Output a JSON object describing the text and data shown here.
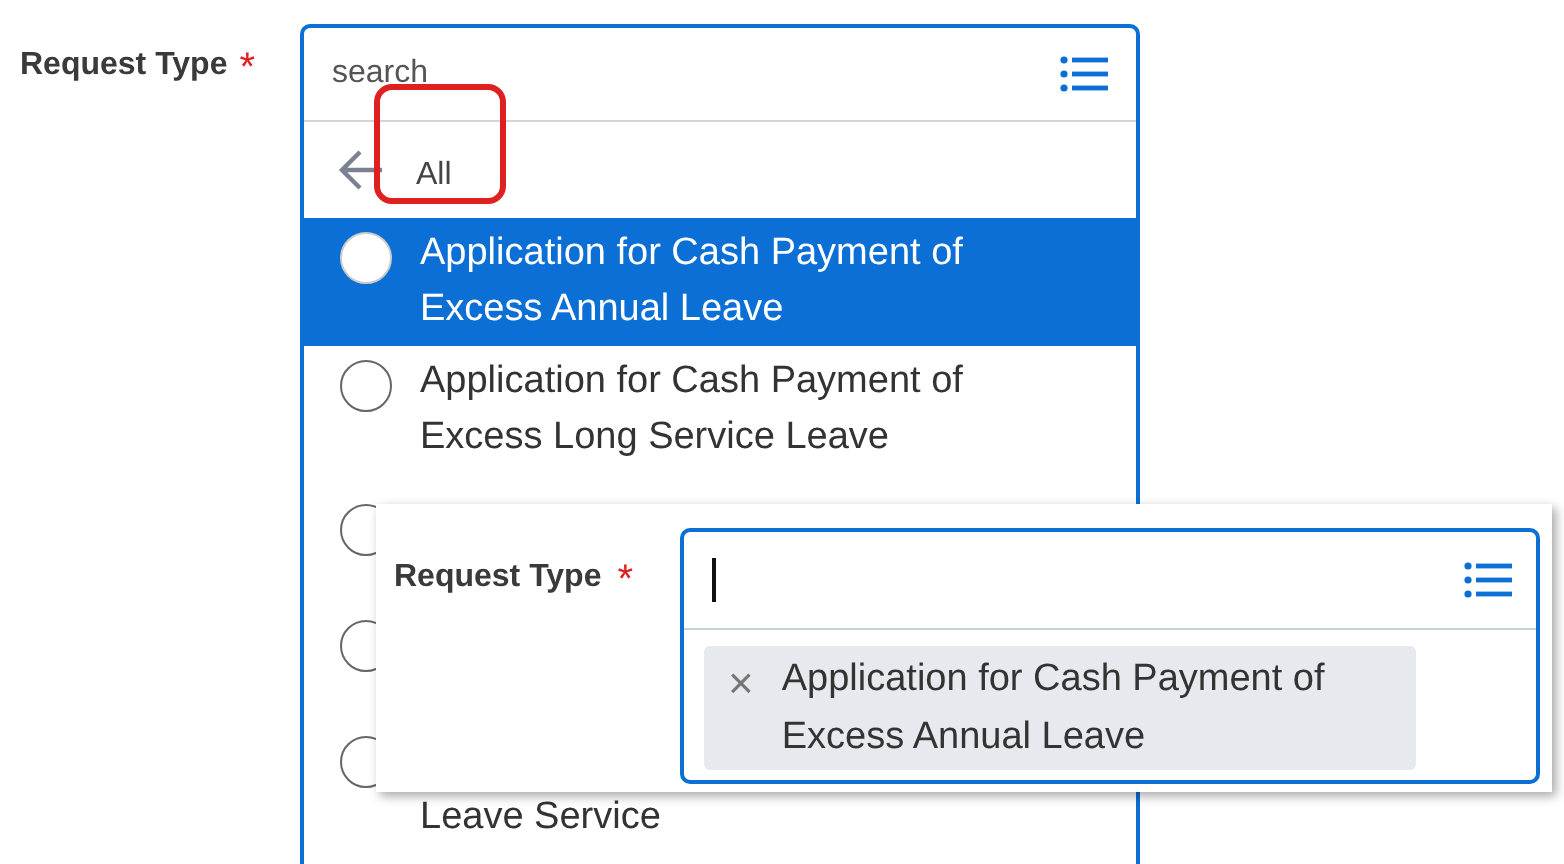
{
  "field": {
    "label": "Request Type",
    "required_mark": "*",
    "placeholder": "search"
  },
  "back": {
    "label": "All"
  },
  "options": [
    {
      "kind": "full",
      "label": "Application for Cash Payment of Excess Annual Leave",
      "selected": true
    },
    {
      "kind": "full",
      "label": "Application for Cash Payment of Excess Long Service Leave",
      "selected": false
    },
    {
      "kind": "covered",
      "selected": false
    },
    {
      "kind": "covered",
      "selected": false
    },
    {
      "kind": "covered",
      "label": "Leave Service",
      "selected": false
    }
  ],
  "overlay": {
    "label": "Request Type",
    "required_mark": "*",
    "chips": [
      {
        "label": "Application for Cash Payment of Excess Annual Leave",
        "remove_icon": "×"
      }
    ]
  }
}
